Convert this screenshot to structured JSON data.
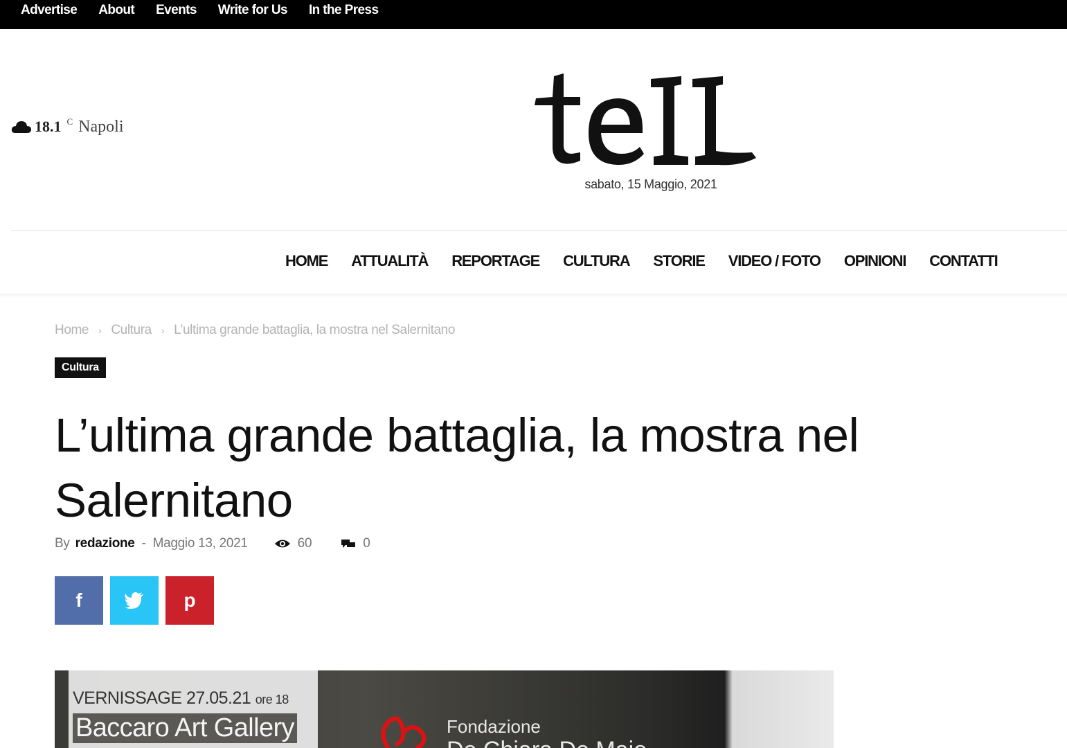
{
  "topbar": {
    "links": [
      "Advertise",
      "About",
      "Events",
      "Write for Us",
      "In the Press"
    ]
  },
  "weather": {
    "icon": "cloud-icon",
    "temp": "18.1",
    "unit": "C",
    "city": "Napoli"
  },
  "header": {
    "logo_text": "tell",
    "date": "sabato, 15 Maggio, 2021"
  },
  "nav": {
    "items": [
      "HOME",
      "ATTUALITÀ",
      "REPORTAGE",
      "CULTURA",
      "STORIE",
      "VIDEO / FOTO",
      "OPINIONI",
      "CONTATTI"
    ]
  },
  "breadcrumb": {
    "home": "Home",
    "section": "Cultura",
    "current": "L’ultima grande battaglia, la mostra nel Salernitano"
  },
  "article": {
    "category": "Cultura",
    "title": "L’ultima grande battaglia, la mostra nel Salernitano",
    "by_label": "By",
    "author": "redazione",
    "date": "Maggio 13, 2021",
    "views": "60",
    "comments": "0"
  },
  "share": {
    "facebook_icon": "f",
    "twitter_icon": "twitter-bird",
    "pinterest_icon": "p"
  },
  "featured_image": {
    "vernissage": "VERNISSAGE 27.05.21",
    "vernissage_time": "ore 18",
    "gallery": "Baccaro Art Gallery",
    "fondazione": "Fondazione",
    "fondazione_name": "De Chiara De Maio"
  },
  "colors": {
    "topbar": "#000000",
    "facebook": "#516eab",
    "twitter": "#29c5f6",
    "pinterest": "#ca212a",
    "category_badge": "#111111"
  }
}
